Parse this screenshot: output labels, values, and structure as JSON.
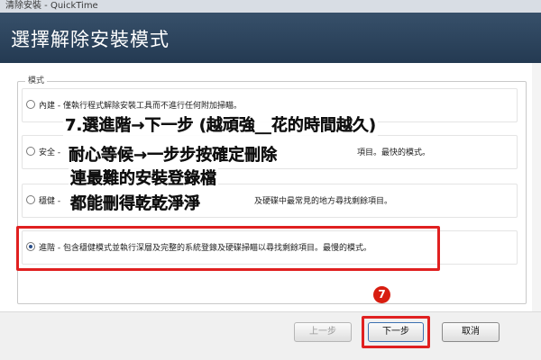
{
  "window": {
    "title": "清除安裝 - QuickTime"
  },
  "header": {
    "title": "選擇解除安裝模式"
  },
  "group": {
    "label": "模式"
  },
  "options": [
    {
      "label": "內建 - 僅執行程式解除安裝工具而不進行任何附加掃瞄。",
      "checked": false
    },
    {
      "label": "安全 -",
      "label_tail": "項目。最快的模式。",
      "checked": false
    },
    {
      "label": "穩健 -",
      "label_tail": "及硬碟中最常見的地方尋找剩餘項目。",
      "checked": false
    },
    {
      "label": "進階 - 包含穩健模式並執行深層及完整的系統登錄及硬碟掃瞄以尋找剩餘項目。最慢的模式。",
      "checked": true
    }
  ],
  "annotations": {
    "line1": "7.選進階→下一步 (越頑強__花的時間越久)",
    "line2": "耐心等候→一步步按確定刪除",
    "line3": "連最難的安裝登錄檔",
    "line4": "都能刪得乾乾淨淨"
  },
  "step_badge": "7",
  "buttons": {
    "back": "上一步",
    "next": "下一步",
    "cancel": "取消"
  },
  "colors": {
    "banner": "#2e4760",
    "highlight": "#e02020",
    "badge": "#d81d10"
  }
}
